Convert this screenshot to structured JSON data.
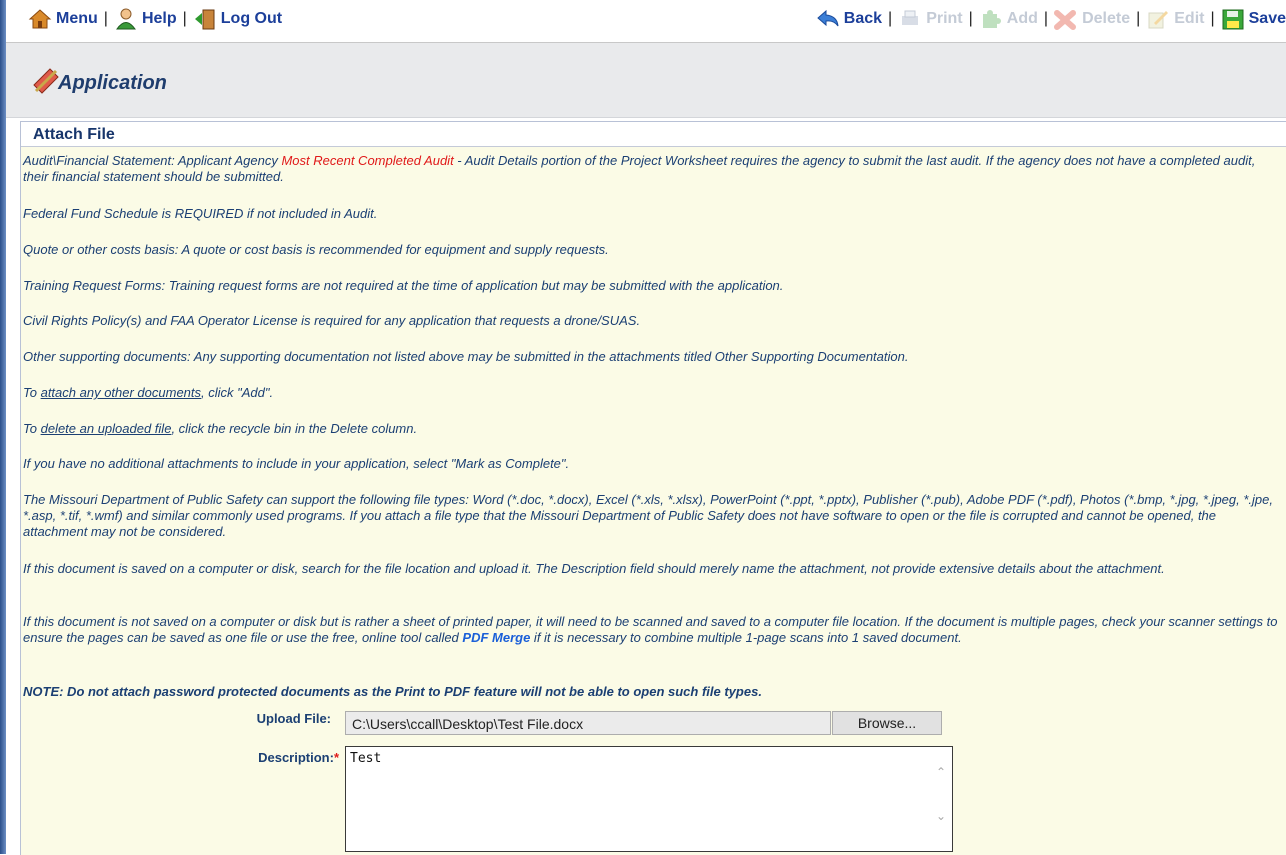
{
  "toolbar": {
    "menu": "Menu",
    "help": "Help",
    "logout": "Log Out",
    "back": "Back",
    "print": "Print",
    "add": "Add",
    "delete": "Delete",
    "edit": "Edit",
    "save": "Save",
    "separator": "|"
  },
  "header": {
    "title": "Application"
  },
  "panel": {
    "title": "Attach File",
    "p1_a": "Audit\\Financial Statement: Applicant Agency ",
    "p1_red": "Most Recent Completed Audit",
    "p1_b": " - Audit Details portion of the Project Worksheet requires the agency to submit the last audit. If the agency does not have a completed audit, their financial statement should be submitted.",
    "p2": "Federal Fund Schedule is REQUIRED if not included in Audit.",
    "p3": "Quote or other costs basis: A quote or cost basis is recommended for equipment and supply requests.",
    "p4": "Training Request Forms: Training request forms are not required at the time of application but may be submitted with the application.",
    "p5": "Civil Rights Policy(s) and FAA Operator License is required for any application that requests a drone/SUAS.",
    "p6": "Other supporting documents: Any supporting documentation not listed above may be submitted in the attachments titled Other Supporting Documentation.",
    "b1_pre": "To ",
    "b1_link": "attach any other documents",
    "b1_post": ", click \"Add\".",
    "b2_pre": "To ",
    "b2_link": "delete an uploaded file",
    "b2_post": ", click the recycle bin in the Delete column.",
    "b3": "If you have no additional attachments to include in your application, select \"Mark as Complete\".",
    "p7": "The Missouri Department of Public Safety can support the following file types: Word (*.doc, *.docx), Excel (*.xls, *.xlsx), PowerPoint (*.ppt, *.pptx), Publisher (*.pub), Adobe PDF (*.pdf), Photos (*.bmp, *.jpg, *.jpeg, *.jpe, *.asp, *.tif, *.wmf) and similar commonly used programs. If you attach a file type that the Missouri Department of Public Safety does not have software to open or the file is corrupted and cannot be opened, the attachment may not be considered.",
    "p8": "If this document is saved on a computer or disk, search for the file location and upload it. The Description field should merely name the attachment, not provide extensive details about the attachment.",
    "p9_a": "If this document is not saved on a computer or disk but is rather a sheet of printed paper, it will need to be scanned and saved to a computer file location. If the document is multiple pages, check your scanner settings to ensure the pages can be saved as one file or use the free, online tool called ",
    "p9_link": "PDF Merge",
    "p9_b": " if it is necessary to combine multiple 1-page scans into 1 saved document.",
    "note": "NOTE: Do not attach password protected documents as the Print to PDF feature will not be able to open such file types.",
    "bullet": "•"
  },
  "form": {
    "upload_label": "Upload File:",
    "upload_value": "C:\\Users\\ccall\\Desktop\\Test File.docx",
    "browse_label": "Browse...",
    "description_label": "Description:",
    "required_mark": "*",
    "description_value": "Test"
  }
}
